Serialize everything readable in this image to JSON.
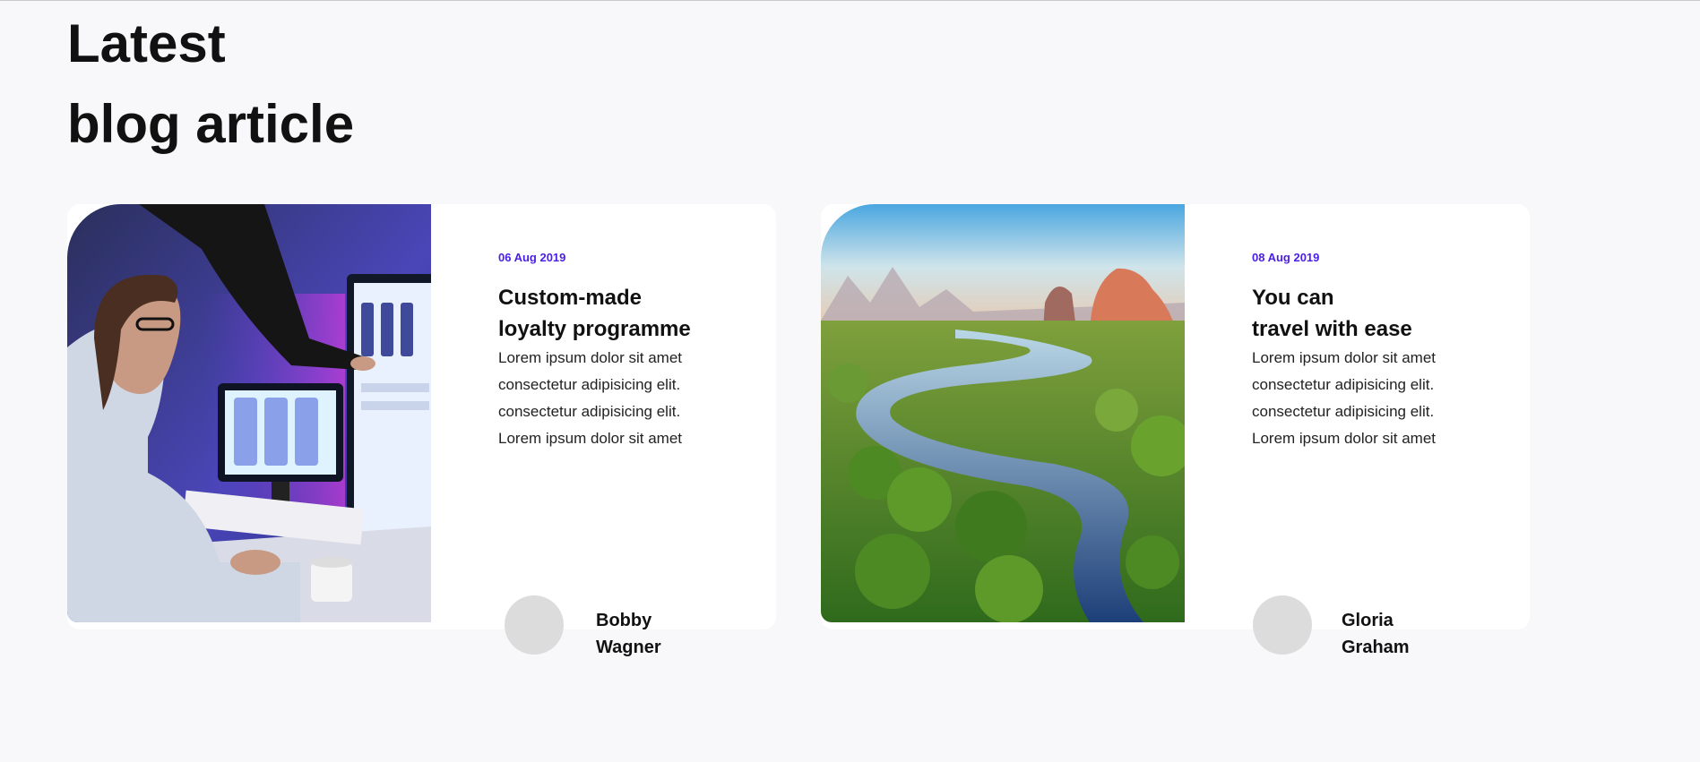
{
  "section": {
    "heading_line1": "Latest",
    "heading_line2": "blog article"
  },
  "colors": {
    "accent": "#4b1fe6",
    "background": "#f8f8fa",
    "card": "#ffffff",
    "avatar": "#dcdcdc"
  },
  "articles": [
    {
      "image": "woman-at-computer-photo",
      "date": "06 Aug 2019",
      "title_line1": "Custom-made",
      "title_line2": "loyalty programme",
      "text": [
        "Lorem ipsum dolor sit amet",
        "consectetur adipisicing elit.",
        "consectetur adipisicing elit.",
        "Lorem ipsum dolor sit amet"
      ],
      "author_first": "Bobby",
      "author_last": "Wagner"
    },
    {
      "image": "river-landscape-photo",
      "date": "08 Aug 2019",
      "title_line1": "You can",
      "title_line2": "travel with ease",
      "text": [
        "Lorem ipsum dolor sit amet",
        "consectetur adipisicing elit.",
        "consectetur adipisicing elit.",
        "Lorem ipsum dolor sit amet"
      ],
      "author_first": "Gloria",
      "author_last": "Graham"
    }
  ]
}
